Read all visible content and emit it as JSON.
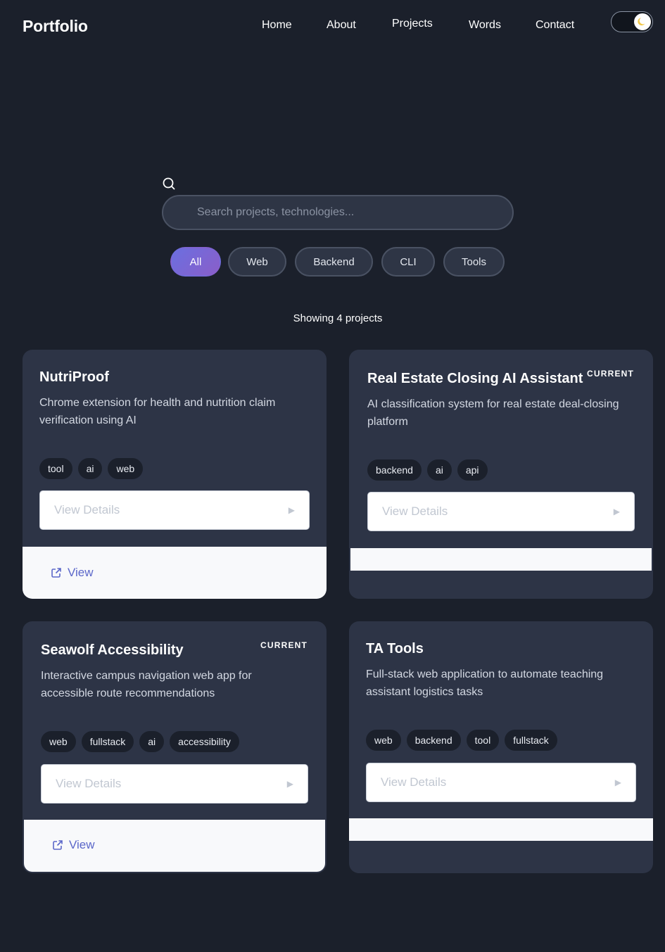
{
  "header": {
    "brand": "Portfolio",
    "nav": [
      {
        "label": "Home"
      },
      {
        "label": "About"
      },
      {
        "label": "Projects"
      },
      {
        "label": "Words"
      },
      {
        "label": "Contact"
      }
    ],
    "theme_toggle_icon": "moon-icon"
  },
  "search": {
    "placeholder": "Search projects, technologies...",
    "value": ""
  },
  "filters": [
    {
      "label": "All",
      "active": true
    },
    {
      "label": "Web",
      "active": false
    },
    {
      "label": "Backend",
      "active": false
    },
    {
      "label": "CLI",
      "active": false
    },
    {
      "label": "Tools",
      "active": false
    }
  ],
  "results_text": "Showing 4 projects",
  "projects": [
    {
      "title": "NutriProof",
      "badge": "",
      "description": "Chrome extension for health and nutrition claim verification using AI",
      "tags": [
        "tool",
        "ai",
        "web"
      ],
      "details_label": "View Details",
      "link_label": "View"
    },
    {
      "title": "Real Estate Closing AI Assistant",
      "badge": "CURRENT",
      "description": "AI classification system for real estate deal-closing platform",
      "tags": [
        "backend",
        "ai",
        "api"
      ],
      "details_label": "View Details",
      "link_label": ""
    },
    {
      "title": "Seawolf Accessibility",
      "badge": "CURRENT",
      "description": "Interactive campus navigation web app for accessible route recommendations",
      "tags": [
        "web",
        "fullstack",
        "ai",
        "accessibility"
      ],
      "details_label": "View Details",
      "link_label": "View"
    },
    {
      "title": "TA Tools",
      "badge": "",
      "description": "Full-stack web application to automate teaching assistant logistics tasks",
      "tags": [
        "web",
        "backend",
        "tool",
        "fullstack"
      ],
      "details_label": "View Details",
      "link_label": ""
    }
  ],
  "colors": {
    "background": "#1b202b",
    "card": "#2d3446",
    "accent_start": "#6b6fe0",
    "accent_end": "#8a5ec9",
    "link": "#5b67c9"
  }
}
